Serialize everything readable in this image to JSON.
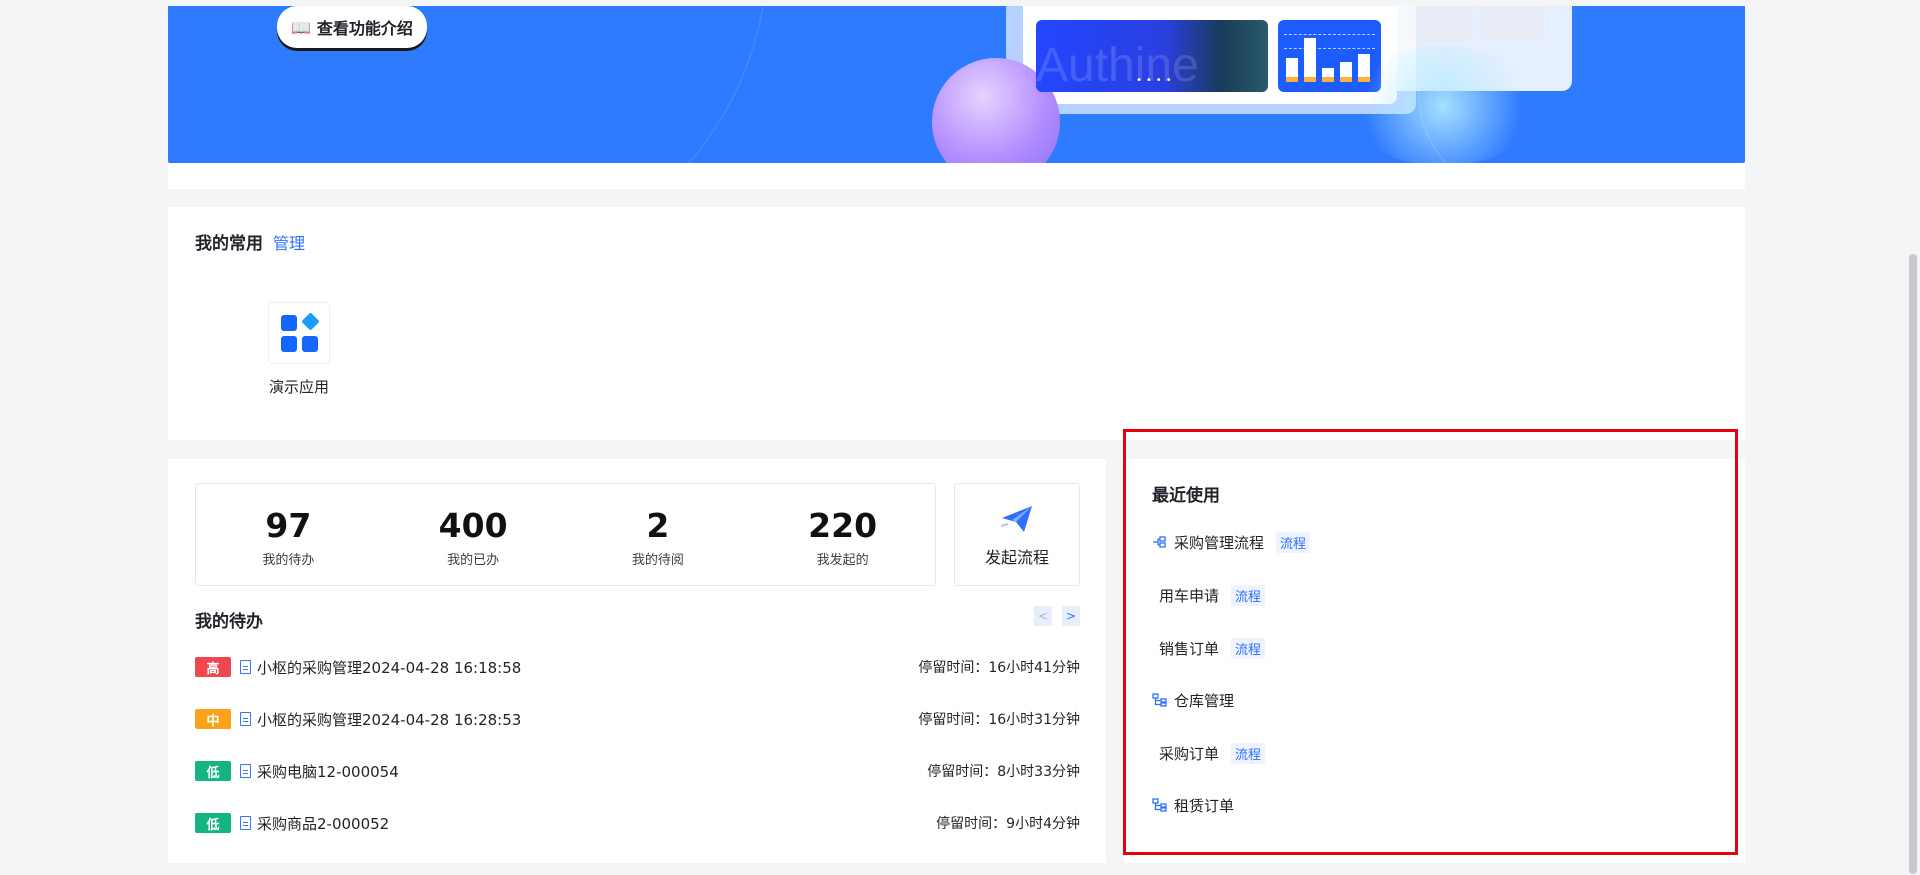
{
  "banner": {
    "guide_button": "查看功能介绍",
    "photo_text": "Authine",
    "colors": {
      "banner_bg": "#2f7bff",
      "accent": "#2e6fff"
    }
  },
  "common": {
    "title": "我的常用",
    "manage_label": "管理",
    "apps": [
      {
        "label": "演示应用",
        "icon": "grid-app-icon"
      }
    ]
  },
  "stats": [
    {
      "value": "97",
      "label": "我的待办"
    },
    {
      "value": "400",
      "label": "我的已办"
    },
    {
      "value": "2",
      "label": "我的待阅"
    },
    {
      "value": "220",
      "label": "我发起的"
    }
  ],
  "launch": {
    "label": "发起流程",
    "icon": "paper-plane-icon"
  },
  "todo": {
    "title": "我的待办",
    "pager": {
      "prev": "<",
      "next": ">"
    },
    "items": [
      {
        "priority": "高",
        "color": "#f0464f",
        "name": "小枢的采购管理2024-04-28 16:18:58",
        "stay": "停留时间：16小时41分钟"
      },
      {
        "priority": "中",
        "color": "#faa21a",
        "name": "小枢的采购管理2024-04-28 16:28:53",
        "stay": "停留时间：16小时31分钟"
      },
      {
        "priority": "低",
        "color": "#16b483",
        "name": "采购电脑12-000054",
        "stay": "停留时间：8小时33分钟"
      },
      {
        "priority": "低",
        "color": "#16b483",
        "name": "采购商品2-000052",
        "stay": "停留时间：9小时4分钟"
      }
    ]
  },
  "recent": {
    "title": "最近使用",
    "items": [
      {
        "icon": "workflow-icon",
        "name": "采购管理流程",
        "tag": "流程"
      },
      {
        "icon": "",
        "name": "用车申请",
        "tag": "流程"
      },
      {
        "icon": "",
        "name": "销售订单",
        "tag": "流程"
      },
      {
        "icon": "tree-icon",
        "name": "仓库管理",
        "tag": ""
      },
      {
        "icon": "",
        "name": "采购订单",
        "tag": "流程"
      },
      {
        "icon": "tree-icon",
        "name": "租赁订单",
        "tag": ""
      }
    ]
  }
}
